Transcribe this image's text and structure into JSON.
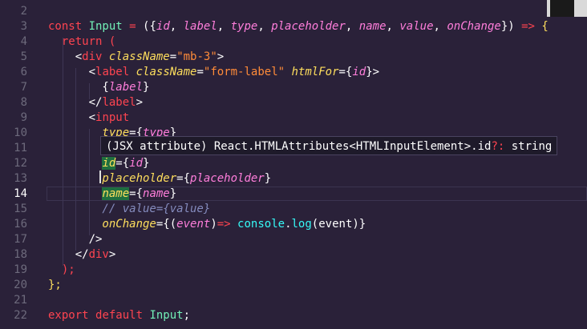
{
  "lines": [
    {
      "n": "2",
      "parts": []
    },
    {
      "n": "3",
      "parts": [
        {
          "t": "const ",
          "c": "pk"
        },
        {
          "t": "Input",
          "c": "var"
        },
        {
          "t": " = ",
          "c": "pk"
        },
        {
          "t": "({",
          "c": "pl"
        },
        {
          "t": "id",
          "c": "prm"
        },
        {
          "t": ", ",
          "c": "pl"
        },
        {
          "t": "label",
          "c": "prm"
        },
        {
          "t": ", ",
          "c": "pl"
        },
        {
          "t": "type",
          "c": "prm"
        },
        {
          "t": ", ",
          "c": "pl"
        },
        {
          "t": "placeholder",
          "c": "prm"
        },
        {
          "t": ", ",
          "c": "pl"
        },
        {
          "t": "name",
          "c": "prm"
        },
        {
          "t": ", ",
          "c": "pl"
        },
        {
          "t": "value",
          "c": "prm"
        },
        {
          "t": ", ",
          "c": "pl"
        },
        {
          "t": "onChange",
          "c": "prm"
        },
        {
          "t": "}) ",
          "c": "pl"
        },
        {
          "t": "=> ",
          "c": "pk"
        },
        {
          "t": "{",
          "c": "kw"
        }
      ]
    },
    {
      "n": "4",
      "parts": [
        {
          "t": "  return ",
          "c": "pk"
        },
        {
          "t": "(",
          "c": "pk"
        }
      ]
    },
    {
      "n": "5",
      "parts": [
        {
          "t": "    <",
          "c": "pl"
        },
        {
          "t": "div",
          "c": "tag"
        },
        {
          "t": " className",
          "c": "attr"
        },
        {
          "t": "=",
          "c": "pl"
        },
        {
          "t": "\"mb-3\"",
          "c": "str"
        },
        {
          "t": ">",
          "c": "pl"
        }
      ]
    },
    {
      "n": "6",
      "parts": [
        {
          "t": "      <",
          "c": "pl"
        },
        {
          "t": "label",
          "c": "tag"
        },
        {
          "t": " className",
          "c": "attr"
        },
        {
          "t": "=",
          "c": "pl"
        },
        {
          "t": "\"form-label\"",
          "c": "str"
        },
        {
          "t": " htmlFor",
          "c": "attr"
        },
        {
          "t": "={",
          "c": "pl"
        },
        {
          "t": "id",
          "c": "prm"
        },
        {
          "t": "}>",
          "c": "pl"
        }
      ]
    },
    {
      "n": "7",
      "parts": [
        {
          "t": "        {",
          "c": "pl"
        },
        {
          "t": "label",
          "c": "prm"
        },
        {
          "t": "}",
          "c": "pl"
        }
      ]
    },
    {
      "n": "8",
      "parts": [
        {
          "t": "      </",
          "c": "pl"
        },
        {
          "t": "label",
          "c": "tag"
        },
        {
          "t": ">",
          "c": "pl"
        }
      ]
    },
    {
      "n": "9",
      "parts": [
        {
          "t": "      <",
          "c": "pl"
        },
        {
          "t": "input",
          "c": "tag"
        }
      ]
    },
    {
      "n": "10",
      "parts": [
        {
          "t": "        type",
          "c": "attr"
        },
        {
          "t": "={",
          "c": "pl"
        },
        {
          "t": "type",
          "c": "prm"
        },
        {
          "t": "}",
          "c": "pl"
        }
      ]
    },
    {
      "n": "11",
      "parts": []
    },
    {
      "n": "12",
      "parts": [
        {
          "t": "        ",
          "c": "pl"
        },
        {
          "t": "id",
          "c": "attr mh"
        },
        {
          "t": "={",
          "c": "pl"
        },
        {
          "t": "id",
          "c": "prm"
        },
        {
          "t": "}",
          "c": "pl"
        }
      ]
    },
    {
      "n": "13",
      "parts": [
        {
          "t": "        placeholder",
          "c": "attr"
        },
        {
          "t": "={",
          "c": "pl"
        },
        {
          "t": "placeholder",
          "c": "prm"
        },
        {
          "t": "}",
          "c": "pl"
        }
      ]
    },
    {
      "n": "14",
      "parts": [
        {
          "t": "        ",
          "c": "pl"
        },
        {
          "t": "name",
          "c": "attr mh"
        },
        {
          "t": "={",
          "c": "pl"
        },
        {
          "t": "name",
          "c": "prm"
        },
        {
          "t": "}",
          "c": "pl"
        }
      ]
    },
    {
      "n": "15",
      "parts": [
        {
          "t": "        // value={value}",
          "c": "cm"
        }
      ]
    },
    {
      "n": "16",
      "parts": [
        {
          "t": "        onChange",
          "c": "attr"
        },
        {
          "t": "={(",
          "c": "pl"
        },
        {
          "t": "event",
          "c": "prm"
        },
        {
          "t": ")",
          "c": "pl"
        },
        {
          "t": "=> ",
          "c": "pk"
        },
        {
          "t": "console",
          "c": "fn"
        },
        {
          "t": ".",
          "c": "pl"
        },
        {
          "t": "log",
          "c": "fn"
        },
        {
          "t": "(event)}",
          "c": "pl"
        }
      ]
    },
    {
      "n": "17",
      "parts": [
        {
          "t": "      />",
          "c": "pl"
        }
      ]
    },
    {
      "n": "18",
      "parts": [
        {
          "t": "    </",
          "c": "pl"
        },
        {
          "t": "div",
          "c": "tag"
        },
        {
          "t": ">",
          "c": "pl"
        }
      ]
    },
    {
      "n": "19",
      "parts": [
        {
          "t": "  ",
          "c": "pl"
        },
        {
          "t": ");",
          "c": "pk"
        }
      ]
    },
    {
      "n": "20",
      "parts": [
        {
          "t": "};",
          "c": "kw"
        }
      ]
    },
    {
      "n": "21",
      "parts": []
    },
    {
      "n": "22",
      "parts": [
        {
          "t": "export ",
          "c": "pk"
        },
        {
          "t": "default ",
          "c": "pk"
        },
        {
          "t": "Input",
          "c": "var"
        },
        {
          "t": ";",
          "c": "pl"
        }
      ]
    }
  ],
  "current_line": "14",
  "tooltip": {
    "prefix": "(JSX attribute) React.HTMLAttributes<HTMLInputElement>.id",
    "suffix": "?: ",
    "type": "string"
  }
}
